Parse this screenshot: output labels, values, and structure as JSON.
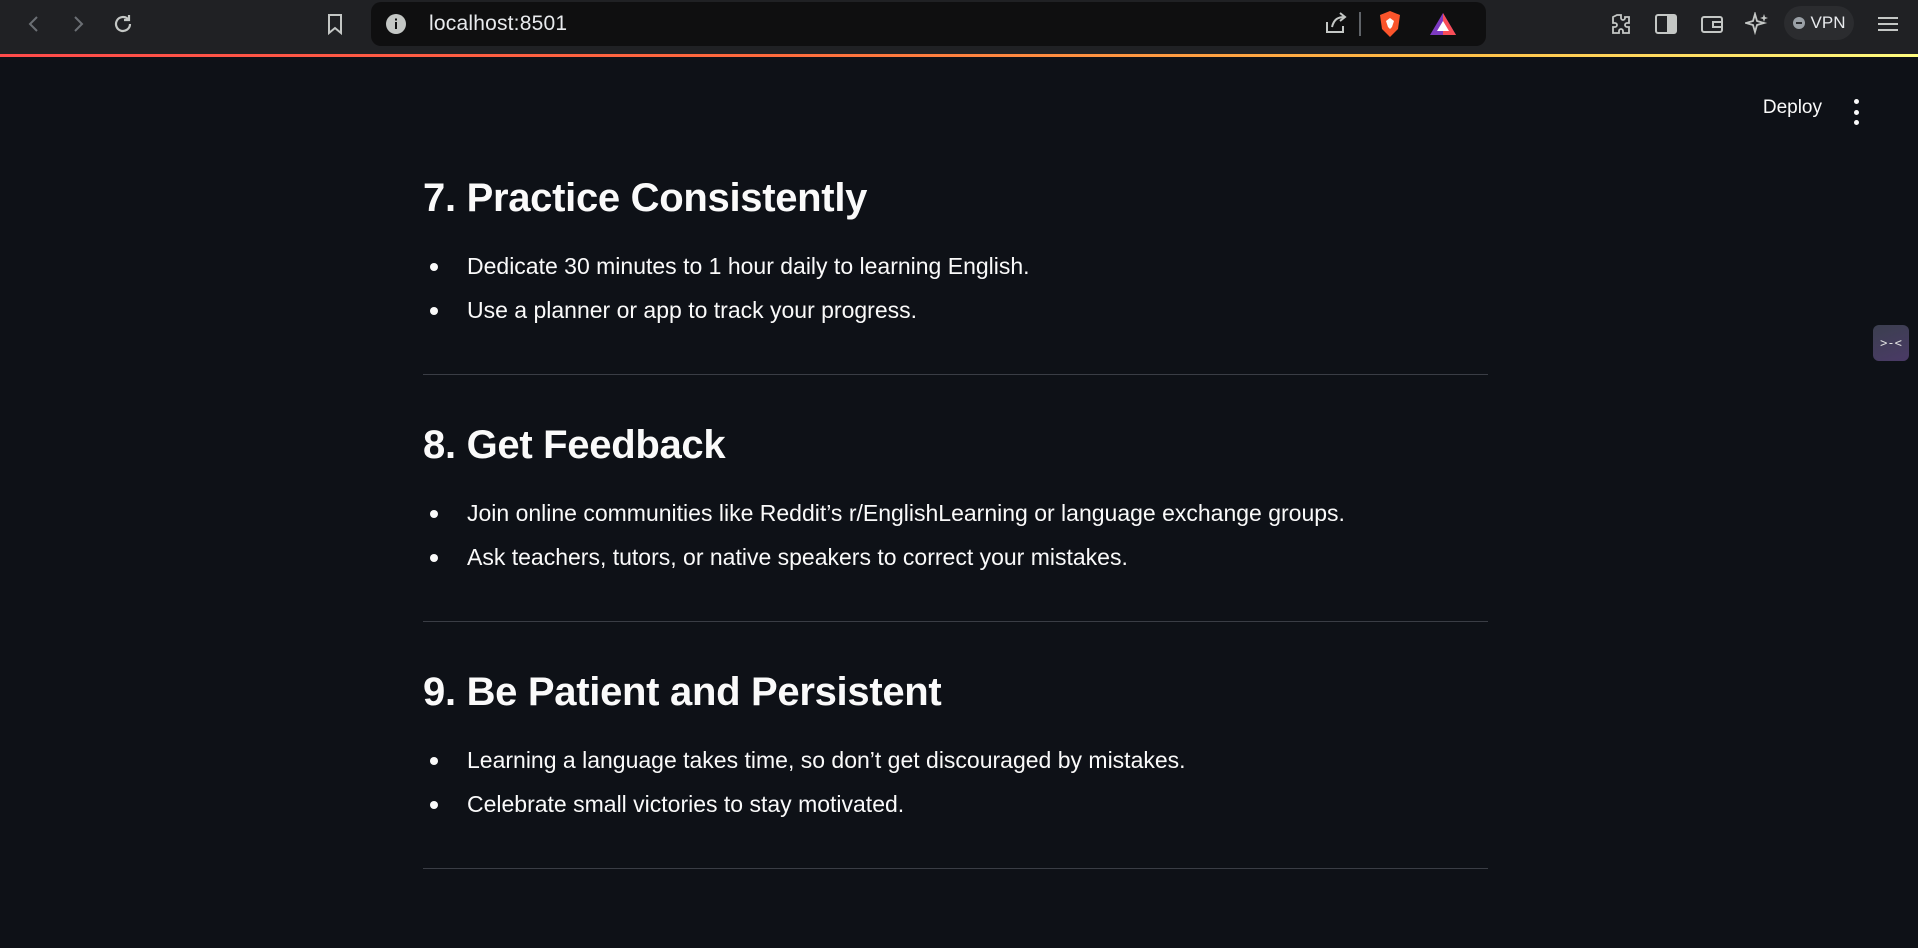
{
  "browser": {
    "url": "localhost:8501",
    "vpn_label": "VPN"
  },
  "header": {
    "deploy_label": "Deploy"
  },
  "sections": [
    {
      "title": "7. Practice Consistently",
      "items": [
        "Dedicate 30 minutes to 1 hour daily to learning English.",
        "Use a planner or app to track your progress."
      ]
    },
    {
      "title": "8. Get Feedback",
      "items": [
        "Join online communities like Reddit’s r/EnglishLearning or language exchange groups.",
        "Ask teachers, tutors, or native speakers to correct your mistakes."
      ]
    },
    {
      "title": "9. Be Patient and Persistent",
      "items": [
        "Learning a language takes time, so don’t get discouraged by mistakes.",
        "Celebrate small victories to stay motivated."
      ]
    }
  ],
  "colors": {
    "background": "#0e1117",
    "text": "#fafafa",
    "browser_chrome": "#202124",
    "accent_gradient_start": "#ff4b4b",
    "accent_gradient_end": "#fffd80"
  }
}
